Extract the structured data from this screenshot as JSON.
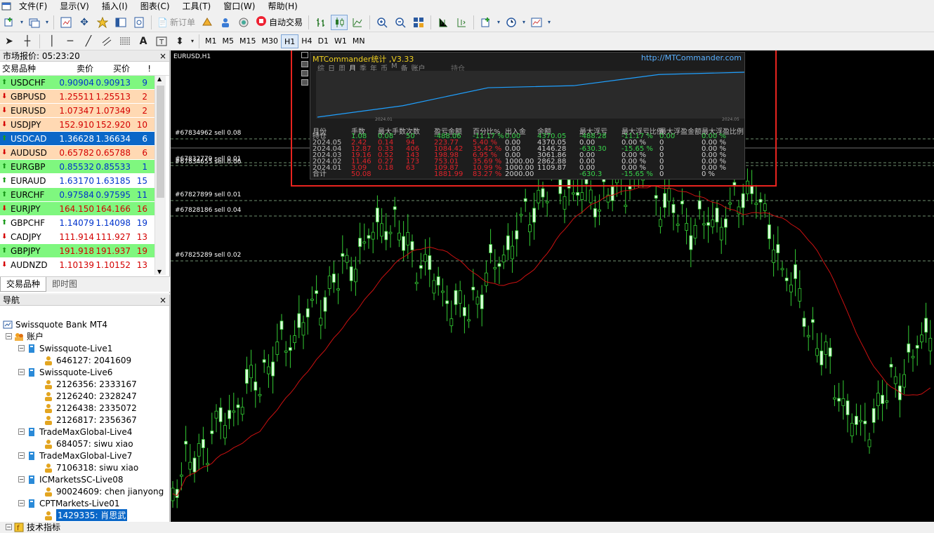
{
  "menu": {
    "items": [
      "文件(F)",
      "显示(V)",
      "插入(I)",
      "图表(C)",
      "工具(T)",
      "窗口(W)",
      "帮助(H)"
    ]
  },
  "toolbar": {
    "new_order": "新订单",
    "auto_trade": "自动交易",
    "timeframes": [
      "M1",
      "M5",
      "M15",
      "M30",
      "H1",
      "H4",
      "D1",
      "W1",
      "MN"
    ],
    "active_timeframe": "H1"
  },
  "market_watch": {
    "title": "市场报价: 05:23:20",
    "headers": {
      "symbol": "交易品种",
      "bid": "卖价",
      "ask": "买价",
      "spread": "!"
    },
    "rows": [
      {
        "symbol": "USDCHF",
        "bid": "0.90904",
        "ask": "0.90913",
        "spread": "9",
        "dir": "up",
        "bg": "#7ff77f",
        "color": "#0033cc"
      },
      {
        "symbol": "GBPUSD",
        "bid": "1.25511",
        "ask": "1.25513",
        "spread": "2",
        "dir": "down",
        "bg": "#ffd9b3",
        "color": "#d40000"
      },
      {
        "symbol": "EURUSD",
        "bid": "1.07347",
        "ask": "1.07349",
        "spread": "2",
        "dir": "down",
        "bg": "#ffd9b3",
        "color": "#d40000"
      },
      {
        "symbol": "USDJPY",
        "bid": "152.910",
        "ask": "152.920",
        "spread": "10",
        "dir": "down",
        "bg": "#ffd9b3",
        "color": "#d40000"
      },
      {
        "symbol": "USDCAD",
        "bid": "1.36628",
        "ask": "1.36634",
        "spread": "6",
        "dir": "up",
        "bg": "#0a67c8",
        "color": "#ffffff"
      },
      {
        "symbol": "AUDUSD",
        "bid": "0.65782",
        "ask": "0.65788",
        "spread": "6",
        "dir": "down",
        "bg": "#ffd9b3",
        "color": "#d40000"
      },
      {
        "symbol": "EURGBP",
        "bid": "0.85532",
        "ask": "0.85533",
        "spread": "1",
        "dir": "up",
        "bg": "#7ff77f",
        "color": "#0033cc"
      },
      {
        "symbol": "EURAUD",
        "bid": "1.63170",
        "ask": "1.63185",
        "spread": "15",
        "dir": "up",
        "bg": "#ffffff",
        "color": "#0033cc"
      },
      {
        "symbol": "EURCHF",
        "bid": "0.97584",
        "ask": "0.97595",
        "spread": "11",
        "dir": "up",
        "bg": "#7ff77f",
        "color": "#0033cc"
      },
      {
        "symbol": "EURJPY",
        "bid": "164.150",
        "ask": "164.166",
        "spread": "16",
        "dir": "down",
        "bg": "#7ff77f",
        "color": "#d40000"
      },
      {
        "symbol": "GBPCHF",
        "bid": "1.14079",
        "ask": "1.14098",
        "spread": "19",
        "dir": "up",
        "bg": "#ffffff",
        "color": "#0033cc"
      },
      {
        "symbol": "CADJPY",
        "bid": "111.914",
        "ask": "111.927",
        "spread": "13",
        "dir": "down",
        "bg": "#ffffff",
        "color": "#d40000"
      },
      {
        "symbol": "GBPJPY",
        "bid": "191.918",
        "ask": "191.937",
        "spread": "19",
        "dir": "up",
        "bg": "#7ff77f",
        "color": "#d40000"
      },
      {
        "symbol": "AUDNZD",
        "bid": "1.10139",
        "ask": "1.10152",
        "spread": "13",
        "dir": "down",
        "bg": "#ffffff",
        "color": "#d40000"
      }
    ],
    "tabs": [
      "交易品种",
      "即时图"
    ]
  },
  "navigator": {
    "title": "导航",
    "root": "Swissquote Bank MT4",
    "accounts_label": "账户",
    "servers": [
      {
        "name": "Swissquote-Live1",
        "accounts": [
          "646127: 2041609"
        ]
      },
      {
        "name": "Swissquote-Live6",
        "accounts": [
          "2126356: 2333167",
          "2126240: 2328247",
          "2126438: 2335072",
          "2126817: 2356367"
        ]
      },
      {
        "name": "TradeMaxGlobal-Live4",
        "accounts": [
          "684057: siwu xiao"
        ]
      },
      {
        "name": "TradeMaxGlobal-Live7",
        "accounts": [
          "7106318: siwu xiao"
        ]
      },
      {
        "name": "ICMarketsSC-Live08",
        "accounts": [
          "90024609: chen jianyong"
        ]
      },
      {
        "name": "CPTMarkets-Live01",
        "accounts": [
          "1429335: 肖思武"
        ]
      }
    ],
    "indicators_label": "技术指标"
  },
  "chart": {
    "symbol_title": "EURUSD,H1",
    "order_lines": [
      "#67834962 sell 0.08",
      "#67832779 sell 0.01",
      "#67834655 sell 0.06",
      "#67827899 sell 0.01",
      "#67828186 sell 0.04",
      "#67825289 sell 0.02"
    ]
  },
  "stats_panel": {
    "title": "MTCommander统计 ,V3.33",
    "link": "http://MTCommander.com",
    "tabs": [
      "综",
      "日",
      "周",
      "月",
      "季",
      "年",
      "币",
      "M",
      "备",
      "账户"
    ],
    "extra_tab": "持仓",
    "x_start": "2024.01",
    "x_end": "2024.05",
    "headers": [
      "月份",
      "手数",
      "最大手数",
      "次数",
      "盈亏金额",
      "百分比%",
      "出入金",
      "余额",
      "最大浮亏",
      "最大浮亏比例",
      "最大浮盈金额",
      "最大浮盈比例"
    ],
    "rows": [
      {
        "cells": [
          "持仓",
          "1.08",
          "0.08",
          "50",
          "-488.06",
          "-11.17 %",
          "0.00",
          "4370.05",
          "-488.28",
          "-11.17 %",
          "0.00",
          "0.00 %"
        ],
        "color": "#37d24a"
      },
      {
        "cells": [
          "2024.05",
          "2.42",
          "0.14",
          "94",
          "223.77",
          "5.40 %",
          "0.00",
          "4370.05",
          "0.00",
          "0.00 %",
          "0",
          "0.00 %"
        ],
        "color": "#e0232a"
      },
      {
        "cells": [
          "2024.04",
          "12.87",
          "0.33",
          "406",
          "1084.42",
          "35.42 %",
          "0.00",
          "4146.28",
          "-630.30",
          "-15.65 %",
          "0",
          "0.00 %"
        ],
        "color": "#e0232a"
      },
      {
        "cells": [
          "2024.03",
          "19.16",
          "0.52",
          "143",
          "198.98",
          "6.95 %",
          "0.00",
          "3061.86",
          "0.00",
          "0.00 %",
          "0",
          "0.00 %"
        ],
        "color": "#e0232a"
      },
      {
        "cells": [
          "2024.02",
          "11.46",
          "0.27",
          "173",
          "753.01",
          "35.69 %",
          "1000.00",
          "2862.88",
          "0.00",
          "0.00 %",
          "0",
          "0.00 %"
        ],
        "color": "#e0232a"
      },
      {
        "cells": [
          "2024.01",
          "3.09",
          "0.18",
          "63",
          "109.87",
          "10.99 %",
          "1000.00",
          "1109.87",
          "0.00",
          "0.00 %",
          "0",
          "0.00 %"
        ],
        "color": "#e0232a"
      },
      {
        "cells": [
          "合计",
          "50.08",
          "",
          "",
          "1881.99",
          "83.27 %",
          "2000.00",
          "",
          "-630.3",
          "-15.65 %",
          "0",
          "0 %"
        ],
        "color": "#e0232a"
      }
    ],
    "equity_curve": [
      0,
      1109.87,
      2862.88,
      3061.86,
      4146.28,
      4370.05
    ]
  },
  "colors": {
    "bull_candle": "#33cc33",
    "ma_line": "#cc1111",
    "order_line": "#6f8f6f",
    "equity_line": "#1fa0ff",
    "highlight_box": "#e8241f"
  }
}
